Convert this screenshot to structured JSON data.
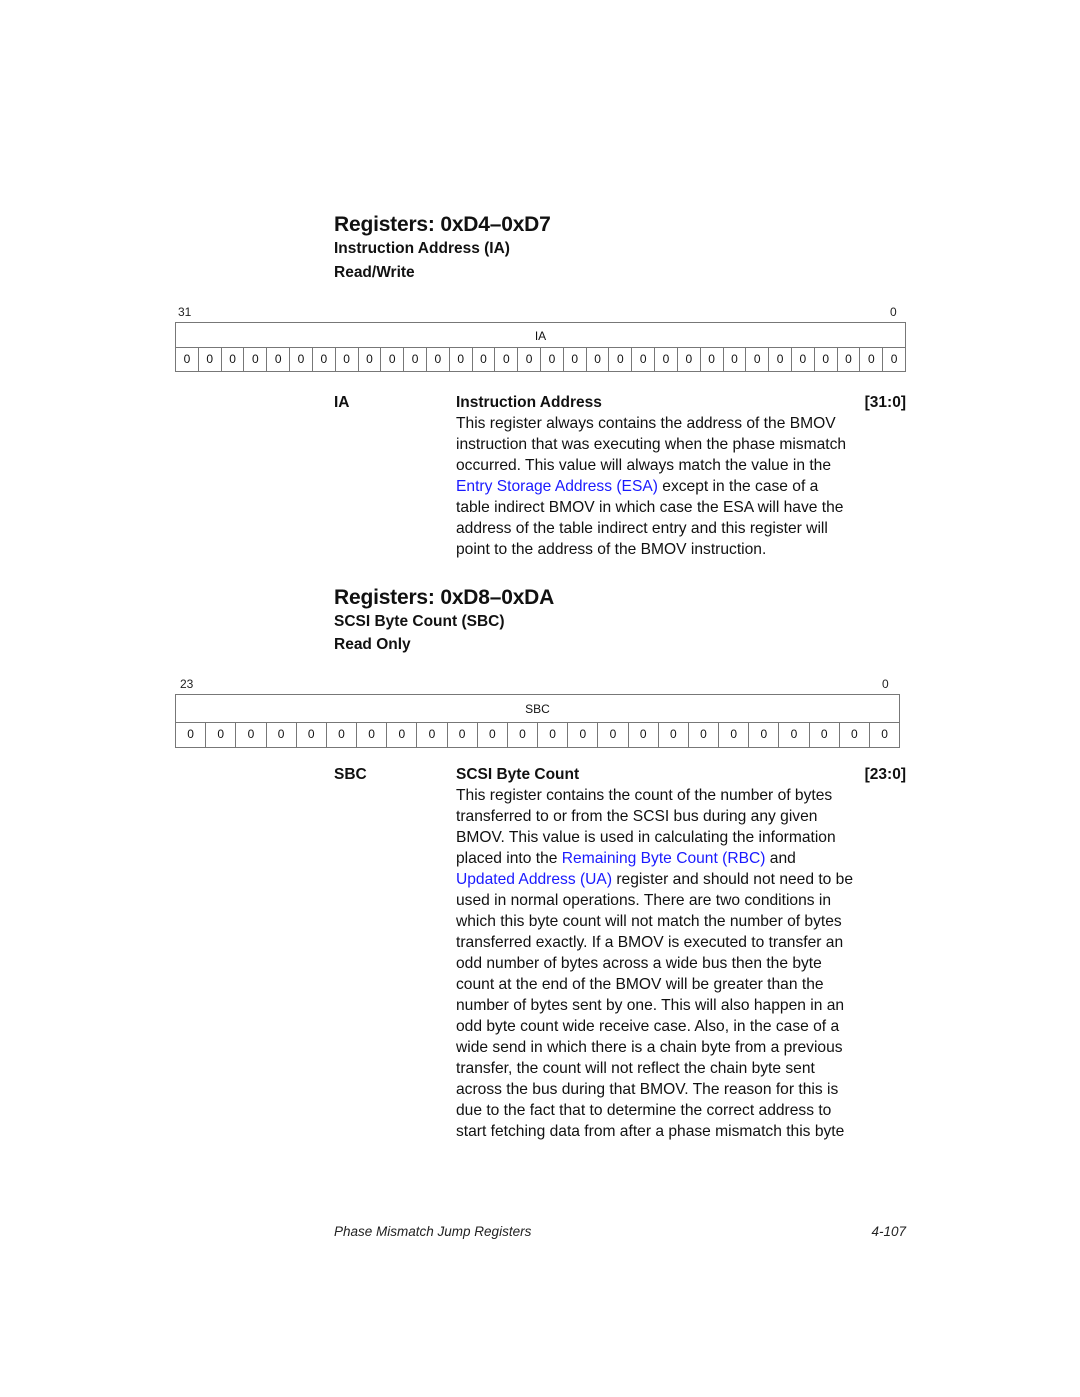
{
  "sections": [
    {
      "title": "Registers: 0xD4–0xD7",
      "subtitle": "Instruction Address (IA)",
      "access": "Read/Write",
      "bit_high": "31",
      "bit_low": "0",
      "field_label": "IA",
      "bits": [
        "0",
        "0",
        "0",
        "0",
        "0",
        "0",
        "0",
        "0",
        "0",
        "0",
        "0",
        "0",
        "0",
        "0",
        "0",
        "0",
        "0",
        "0",
        "0",
        "0",
        "0",
        "0",
        "0",
        "0",
        "0",
        "0",
        "0",
        "0",
        "0",
        "0",
        "0",
        "0"
      ],
      "field": {
        "abbr": "IA",
        "name": "Instruction Address",
        "range": "[31:0]",
        "lines": [
          [
            {
              "t": "This register always contains the address of the BMOV"
            }
          ],
          [
            {
              "t": "instruction that was executing when the phase mismatch"
            }
          ],
          [
            {
              "t": "occurred. This value will always match the value in the"
            }
          ],
          [
            {
              "t": "Entry Storage Address (ESA)",
              "link": true
            },
            {
              "t": " except in the case of a"
            }
          ],
          [
            {
              "t": "table indirect BMOV in which case the ESA will have the"
            }
          ],
          [
            {
              "t": "address of the table indirect entry and this register will"
            }
          ],
          [
            {
              "t": "point to the address of the BMOV instruction."
            }
          ]
        ]
      }
    },
    {
      "title": "Registers: 0xD8–0xDA",
      "subtitle": "SCSI Byte Count (SBC)",
      "access": "Read Only",
      "bit_high": "23",
      "bit_low": "0",
      "field_label": "SBC",
      "bits": [
        "0",
        "0",
        "0",
        "0",
        "0",
        "0",
        "0",
        "0",
        "0",
        "0",
        "0",
        "0",
        "0",
        "0",
        "0",
        "0",
        "0",
        "0",
        "0",
        "0",
        "0",
        "0",
        "0",
        "0"
      ],
      "field": {
        "abbr": "SBC",
        "name": "SCSI Byte Count",
        "range": "[23:0]",
        "lines": [
          [
            {
              "t": "This register contains the count of the number of bytes"
            }
          ],
          [
            {
              "t": "transferred to or from the SCSI bus during any given"
            }
          ],
          [
            {
              "t": "BMOV. This value is used in calculating the information"
            }
          ],
          [
            {
              "t": "placed into the "
            },
            {
              "t": "Remaining Byte Count (RBC)",
              "link": true
            },
            {
              "t": " and"
            }
          ],
          [
            {
              "t": "Updated Address (UA)",
              "link": true
            },
            {
              "t": " register and should not need to be"
            }
          ],
          [
            {
              "t": "used in normal operations. There are two conditions in"
            }
          ],
          [
            {
              "t": "which this byte count will not match the number of bytes"
            }
          ],
          [
            {
              "t": "transferred exactly. If a BMOV is executed to transfer an"
            }
          ],
          [
            {
              "t": "odd number of bytes across a wide bus then the byte"
            }
          ],
          [
            {
              "t": "count at the end of the BMOV will be greater than the"
            }
          ],
          [
            {
              "t": "number of bytes sent by one. This will also happen in an"
            }
          ],
          [
            {
              "t": "odd byte count wide receive case. Also, in the case of a"
            }
          ],
          [
            {
              "t": "wide send in which there is a chain byte from a previous"
            }
          ],
          [
            {
              "t": "transfer, the count will not reflect the chain byte sent"
            }
          ],
          [
            {
              "t": "across the bus during that BMOV. The reason for this is"
            }
          ],
          [
            {
              "t": "due to the fact that to determine the correct address to"
            }
          ],
          [
            {
              "t": "start fetching data from after a phase mismatch this byte"
            }
          ]
        ]
      }
    }
  ],
  "footer": {
    "chapter": "Phase Mismatch Jump Registers",
    "page": "4-107"
  },
  "colors": {
    "link": "#1a1aff",
    "text": "#111111"
  }
}
